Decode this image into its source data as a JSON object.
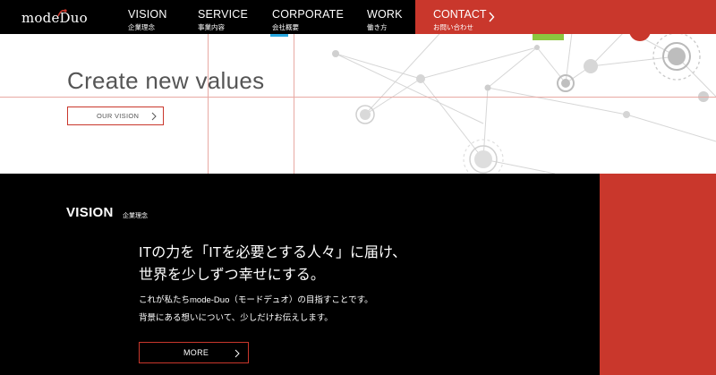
{
  "brand": {
    "logo_text": "modeDuo",
    "accent_color": "#c9372c"
  },
  "nav": {
    "items": [
      {
        "en": "VISION",
        "jp": "企業理念"
      },
      {
        "en": "SERVICE",
        "jp": "事業内容"
      },
      {
        "en": "CORPORATE",
        "jp": "会社概要"
      },
      {
        "en": "WORK",
        "jp": "働き方"
      }
    ],
    "contact": {
      "en": "CONTACT",
      "jp": "お問い合わせ",
      "icon": "chevron-right-icon"
    }
  },
  "hero": {
    "title": "Create new values",
    "button_label": "OUR VISION",
    "button_icon": "chevron-right-icon"
  },
  "vision": {
    "heading": "VISION",
    "heading_sub": "企業理念",
    "lead_lines": [
      "ITの力を「ITを必要とする人々」に届け、",
      "世界を少しずつ幸せにする。"
    ],
    "body_lines": [
      "これが私たちmode-Duo（モードデュオ）の目指すことです。",
      "背景にある想いについて、少しだけお伝えします。"
    ],
    "button_label": "MORE",
    "button_icon": "chevron-right-icon"
  }
}
